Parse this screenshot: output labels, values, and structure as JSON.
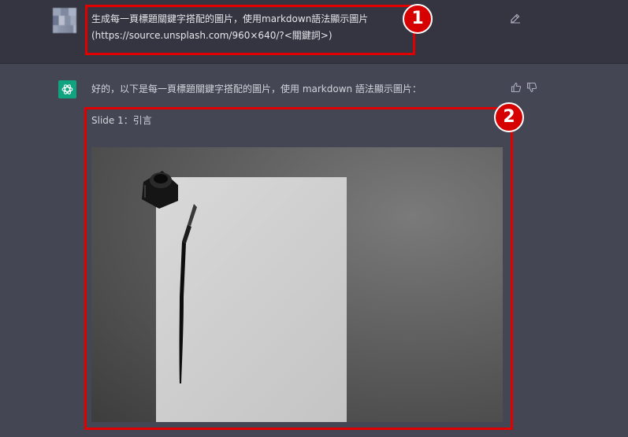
{
  "user_message": {
    "line1": "生成每一頁標題關鍵字搭配的圖片，使用markdown語法顯示圖片",
    "line2": "(https://source.unsplash.com/960×640/?<關鍵詞>)"
  },
  "assistant_message": {
    "intro": "好的，以下是每一頁標題關鍵字搭配的圖片，使用 markdown 語法顯示圖片：",
    "slide_label": "Slide 1：引言"
  },
  "annotations": {
    "badge1": "1",
    "badge2": "2"
  },
  "colors": {
    "user_bg": "#343541",
    "assistant_bg": "#444654",
    "highlight": "#e00000",
    "gpt_green": "#10a37f"
  }
}
